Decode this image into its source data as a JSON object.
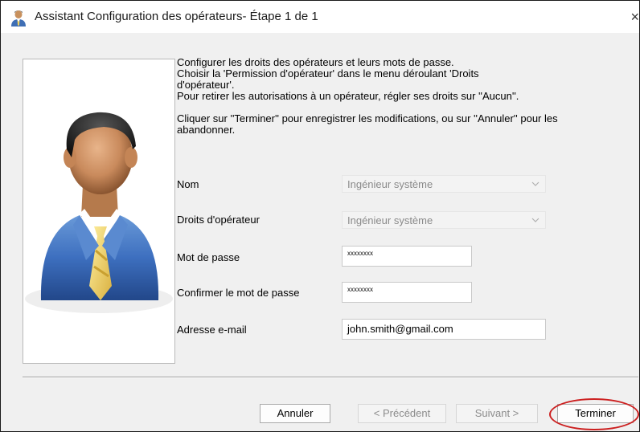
{
  "window": {
    "title": "Assistant Configuration des opérateurs- Étape 1 de 1",
    "close_glyph": "×"
  },
  "description": {
    "paragraph1": "Configurer les droits des opérateurs et leurs mots de passe.\nChoisir la 'Permission d'opérateur' dans le menu déroulant 'Droits\nd'opérateur'.\nPour retirer les autorisations à un opérateur, régler ses droits sur ''Aucun''.",
    "paragraph2": "Cliquer sur ''Terminer'' pour enregistrer les modifications, ou sur ''Annuler'' pour les\nabandonner."
  },
  "form": {
    "nom": {
      "label": "Nom",
      "value": "Ingénieur système"
    },
    "droits": {
      "label": "Droits d'opérateur",
      "value": "Ingénieur système"
    },
    "password": {
      "label": "Mot de passe",
      "value": "xxxxxxxx"
    },
    "confirm": {
      "label": "Confirmer le mot de passe",
      "value": "xxxxxxxx"
    },
    "email": {
      "label": "Adresse e-mail",
      "value": "john.smith@gmail.com"
    }
  },
  "buttons": {
    "cancel": "Annuler",
    "previous": "< Précédent",
    "next": "Suivant >",
    "finish": "Terminer"
  },
  "colors": {
    "highlight": "#cc2020"
  },
  "icons": {
    "app": "operator-user-icon",
    "avatar": "businessman-avatar",
    "dropdown": "chevron-down-icon"
  }
}
